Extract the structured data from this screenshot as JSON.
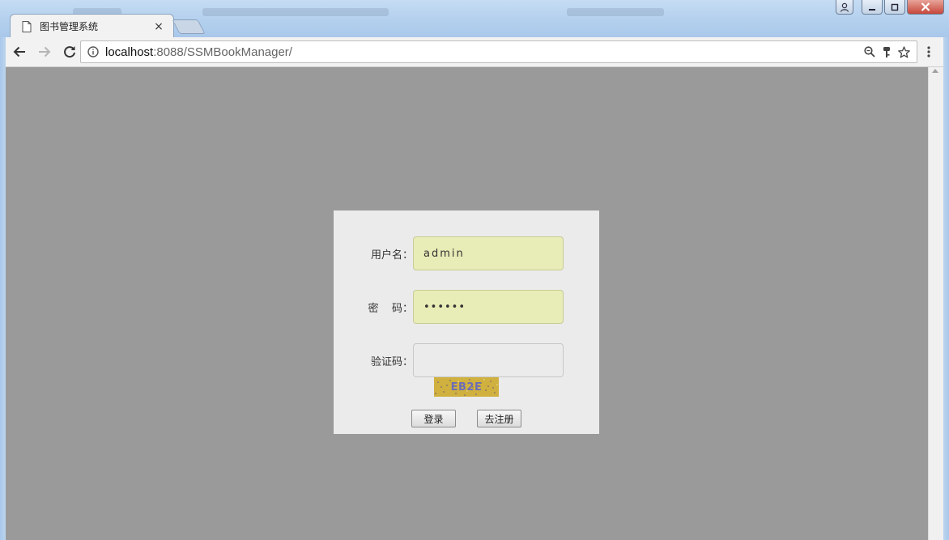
{
  "browser": {
    "tab": {
      "title": "图书管理系统",
      "close_glyph": "×"
    },
    "address": {
      "host": "localhost",
      "rest": ":8088/SSMBookManager/"
    },
    "icons": [
      "document-icon",
      "back-icon",
      "forward-icon",
      "reload-icon",
      "info-icon",
      "zoom-icon",
      "key-icon",
      "star-icon",
      "menu-icon"
    ]
  },
  "login": {
    "username_label": "用户名：",
    "username_value": "admin",
    "password_label": "密    码：",
    "password_value": "••••••",
    "captcha_label": "验证码：",
    "captcha_value": "",
    "captcha_text": "EB2E",
    "login_button": "登录",
    "register_button": "去注册"
  },
  "colors": {
    "page_background": "#9a9a9a",
    "panel_background": "#ebebeb",
    "autofill_background": "#e8ecb6",
    "captcha_background": "#d0b03e",
    "captcha_text": "#6c6db6"
  }
}
